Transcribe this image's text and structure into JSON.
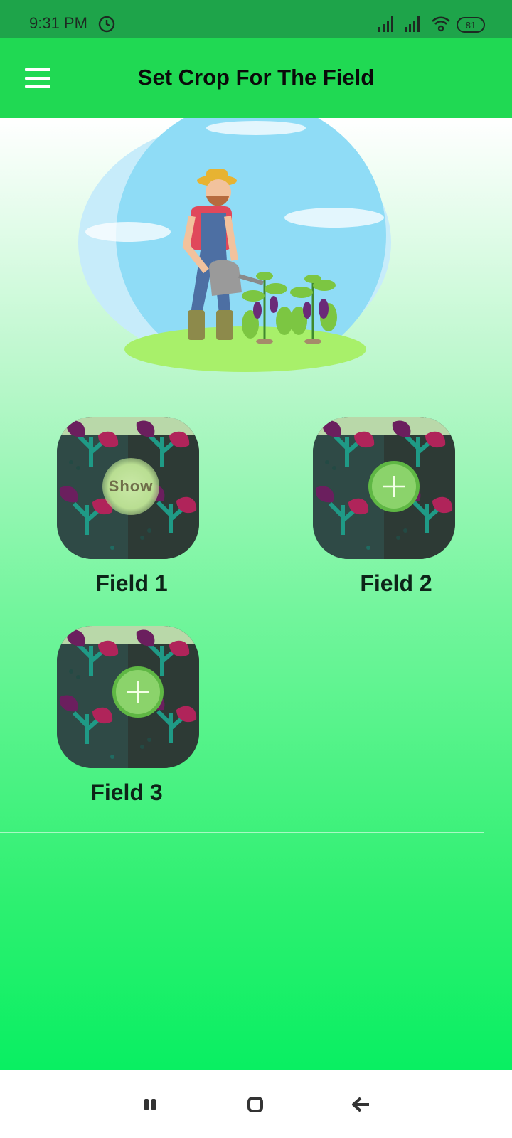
{
  "status_bar": {
    "time": "9:31 PM",
    "battery": "81",
    "icons": [
      "clock-icon",
      "signal-icon",
      "signal-icon",
      "wifi-icon",
      "battery-icon"
    ]
  },
  "app_bar": {
    "title": "Set Crop For The Field",
    "menu_icon": "hamburger-menu-icon",
    "background": "#20d953"
  },
  "hero": {
    "image": "farmer-watering-plants-illustration"
  },
  "fields": [
    {
      "label": "Field 1",
      "action": "Show"
    },
    {
      "label": "Field 2",
      "action_icon": "plus-icon"
    },
    {
      "label": "Field 3",
      "action_icon": "plus-icon"
    }
  ],
  "nav_bar": {
    "icons": [
      "recents-icon",
      "home-icon",
      "back-icon"
    ]
  },
  "colors": {
    "status_bar": "#1ea44a",
    "gradient_top": "#ffffff",
    "gradient_bottom": "#09ef62",
    "add_button": "#8bd36b"
  }
}
